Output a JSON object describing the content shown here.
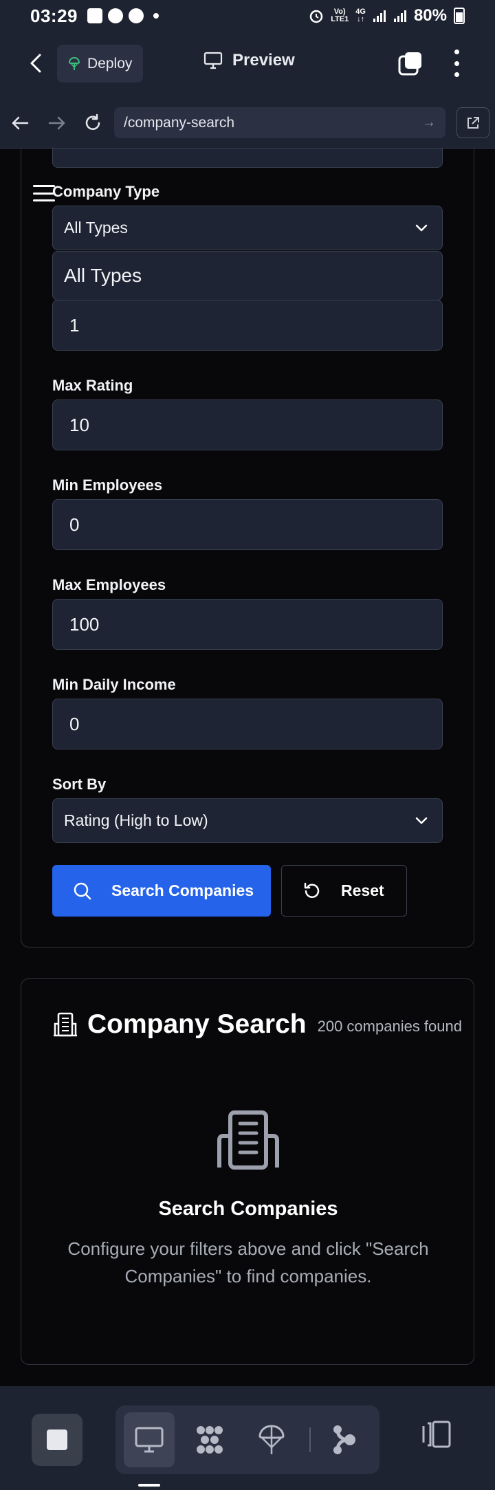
{
  "status_bar": {
    "time": "03:29",
    "network_top": "Vo)",
    "network_bottom": "LTE1",
    "network_type": "4G",
    "battery": "80%"
  },
  "app_bar": {
    "deploy_label": "Deploy",
    "preview_label": "Preview"
  },
  "browser": {
    "url": "/company-search"
  },
  "filters": {
    "company_type_label": "Company Type",
    "company_type_value": "All Types",
    "dropdown_option": "All Types",
    "min_rating_value": "1",
    "max_rating_label": "Max Rating",
    "max_rating_value": "10",
    "min_employees_label": "Min Employees",
    "min_employees_value": "0",
    "max_employees_label": "Max Employees",
    "max_employees_value": "100",
    "min_daily_income_label": "Min Daily Income",
    "min_daily_income_value": "0",
    "sort_by_label": "Sort By",
    "sort_by_value": "Rating (High to Low)",
    "search_button": "Search Companies",
    "reset_button": "Reset"
  },
  "results": {
    "title": "Company Search",
    "count": "200 companies found",
    "empty_title": "Search Companies",
    "empty_description": "Configure your filters above and click \"Search Companies\" to find companies."
  },
  "colors": {
    "primary": "#2563eb",
    "surface": "#1e2331",
    "background": "#08080a"
  },
  "icons": {
    "back": "chevron-left-icon",
    "deploy": "deploy-icon",
    "preview": "monitor-icon",
    "tabs": "tabs-icon",
    "menu": "kebab-menu-icon",
    "search": "search-icon",
    "reset": "reset-icon",
    "company": "building-icon"
  }
}
